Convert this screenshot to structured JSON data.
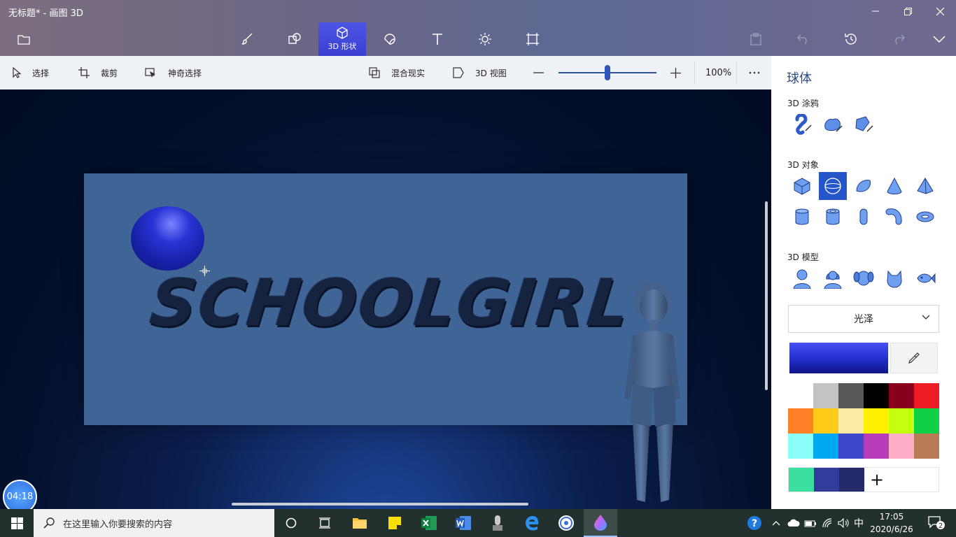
{
  "window": {
    "title": "无标题* - 画图 3D"
  },
  "toolbar": {
    "active_tool_label": "3D 形状"
  },
  "commands": {
    "select": "选择",
    "crop": "裁剪",
    "magic_select": "神奇选择",
    "mixed_reality": "混合现实",
    "view_3d": "3D 视图",
    "zoom": "100%",
    "zoom_level": 0.5
  },
  "canvas": {
    "text_art": "SCHOOLGIRL"
  },
  "timer": {
    "value": "04:18"
  },
  "panel": {
    "title": "球体",
    "doodle_heading": "3D 涂鸦",
    "objects_heading": "3D 对象",
    "models_heading": "3D 模型",
    "material": "光泽",
    "current_color": "#2530d0",
    "palette": [
      "#ffffff",
      "#c3c3c3",
      "#585858",
      "#000000",
      "#88001b",
      "#ec1c24",
      "#ff7f27",
      "#ffca18",
      "#fdeca6",
      "#fff200",
      "#c4ff0e",
      "#0ed145",
      "#8cfffb",
      "#00a8f3",
      "#3f48cc",
      "#b83dba",
      "#ffaec8",
      "#b97a56"
    ],
    "custom_colors": [
      "#3be0a0",
      "#323c9a",
      "#252a6a"
    ]
  },
  "taskbar": {
    "search_placeholder": "在这里输入你要搜索的内容",
    "ime": "中",
    "time": "17:05",
    "date": "2020/6/26",
    "notifications": "2"
  }
}
